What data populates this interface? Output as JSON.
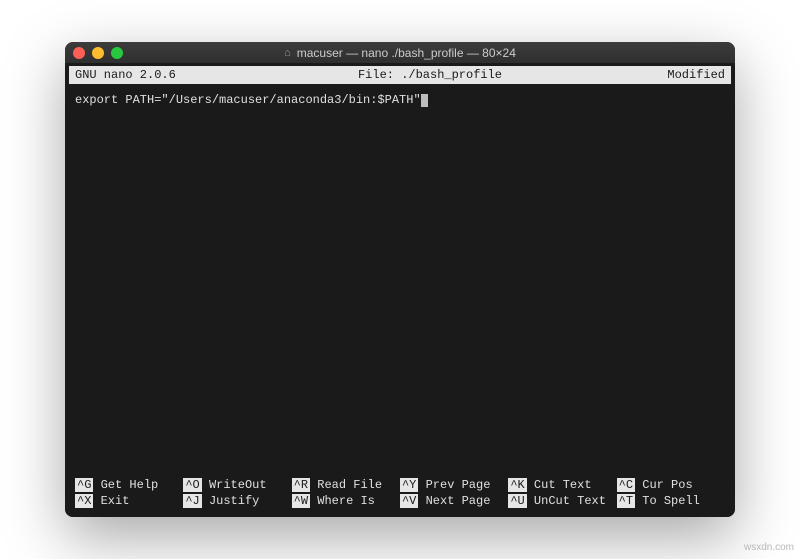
{
  "window": {
    "title": "macuser — nano ./bash_profile — 80×24"
  },
  "nano": {
    "version": "GNU nano 2.0.6",
    "file_label": "File: ./bash_profile",
    "status": "Modified"
  },
  "editor": {
    "content": "export PATH=\"/Users/macuser/anaconda3/bin:$PATH\""
  },
  "shortcuts": {
    "row1": [
      {
        "key": "^G",
        "label": "Get Help"
      },
      {
        "key": "^O",
        "label": "WriteOut"
      },
      {
        "key": "^R",
        "label": "Read File"
      },
      {
        "key": "^Y",
        "label": "Prev Page"
      },
      {
        "key": "^K",
        "label": "Cut Text"
      },
      {
        "key": "^C",
        "label": "Cur Pos"
      }
    ],
    "row2": [
      {
        "key": "^X",
        "label": "Exit"
      },
      {
        "key": "^J",
        "label": "Justify"
      },
      {
        "key": "^W",
        "label": "Where Is"
      },
      {
        "key": "^V",
        "label": "Next Page"
      },
      {
        "key": "^U",
        "label": "UnCut Text"
      },
      {
        "key": "^T",
        "label": "To Spell"
      }
    ]
  },
  "watermark": "wsxdn.com"
}
